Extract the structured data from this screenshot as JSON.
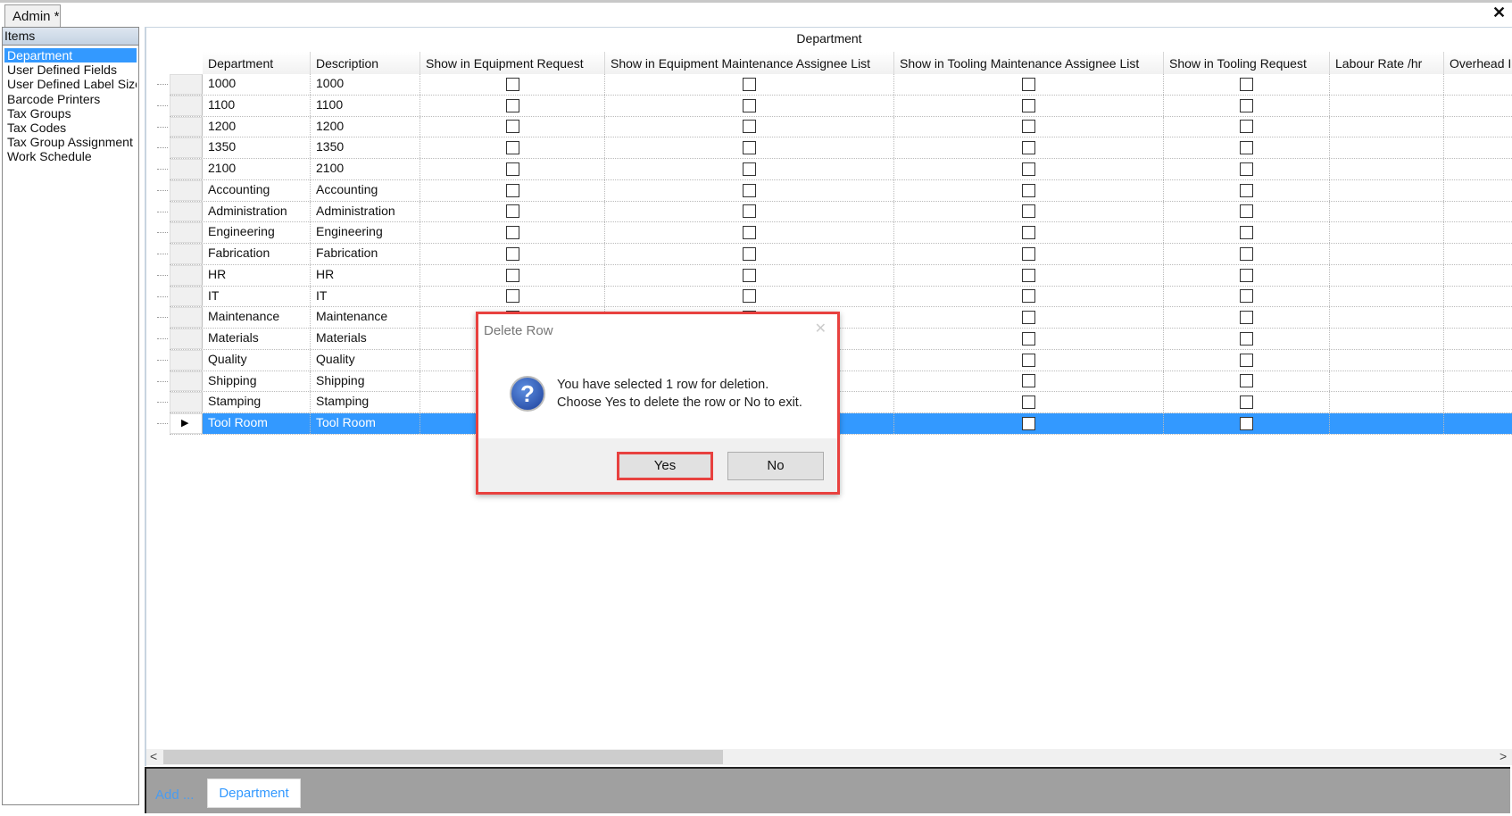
{
  "tab": {
    "label": "Admin *"
  },
  "left_panel": {
    "header": "Items",
    "items": [
      "Department",
      "User Defined Fields",
      "User Defined Label Sizes",
      "Barcode Printers",
      "Tax Groups",
      "Tax Codes",
      "Tax Group Assignment",
      "Work Schedule"
    ],
    "selected": "Department"
  },
  "grid": {
    "caption": "Department",
    "columns": [
      "Department",
      "Description",
      "Show in Equipment Request",
      "Show in Equipment Maintenance Assignee List",
      "Show in Tooling Maintenance Assignee List",
      "Show in Tooling Request",
      "Labour Rate /hr",
      "Overhead I"
    ],
    "rows": [
      [
        "1000",
        "1000"
      ],
      [
        "1100",
        "1100"
      ],
      [
        "1200",
        "1200"
      ],
      [
        "1350",
        "1350"
      ],
      [
        "2100",
        "2100"
      ],
      [
        "Accounting",
        "Accounting"
      ],
      [
        "Administration",
        "Administration"
      ],
      [
        "Engineering",
        "Engineering"
      ],
      [
        "Fabrication",
        "Fabrication"
      ],
      [
        "HR",
        "HR"
      ],
      [
        "IT",
        "IT"
      ],
      [
        "Maintenance",
        "Maintenance"
      ],
      [
        "Materials",
        "Materials"
      ],
      [
        "Quality",
        "Quality"
      ],
      [
        "Shipping",
        "Shipping"
      ],
      [
        "Stamping",
        "Stamping"
      ],
      [
        "Tool Room",
        "Tool Room"
      ]
    ],
    "selected_row": "Tool Room"
  },
  "bottom": {
    "add_label": "Add ...",
    "department_button": "Department"
  },
  "dialog": {
    "title": "Delete Row",
    "line1": "You have selected 1 row for deletion.",
    "line2": "Choose Yes to delete the row or No to exit.",
    "yes": "Yes",
    "no": "No",
    "icon": "question-icon"
  },
  "colors": {
    "selection": "#3399ff",
    "highlight": "#e8413f"
  }
}
